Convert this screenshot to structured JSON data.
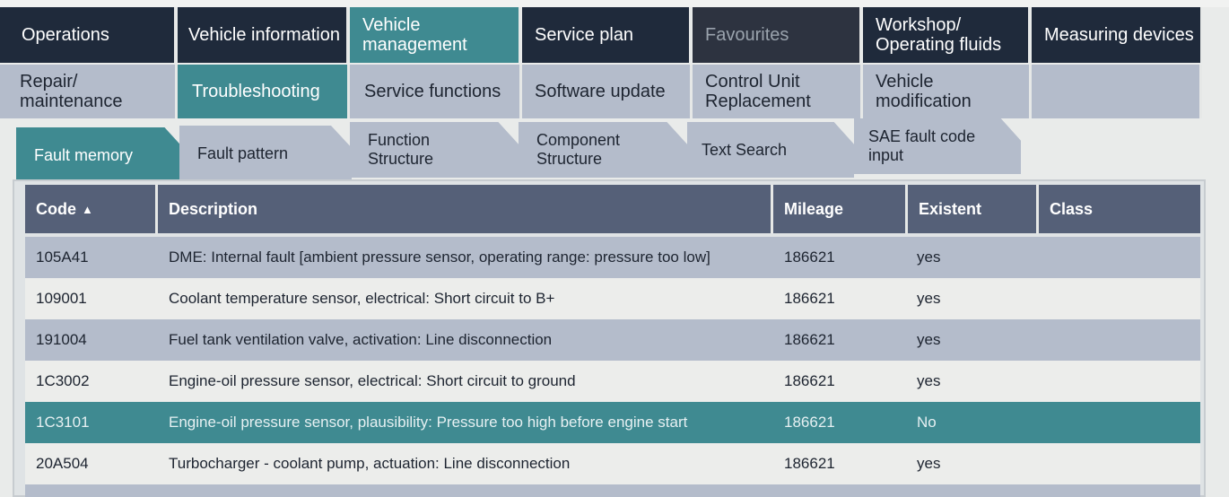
{
  "nav_main": [
    {
      "label": "Operations",
      "state": "dark"
    },
    {
      "label": "Vehicle information",
      "state": "dark"
    },
    {
      "label": "Vehicle management",
      "state": "active"
    },
    {
      "label": "Service plan",
      "state": "dark"
    },
    {
      "label": "Favourites",
      "state": "disabled"
    },
    {
      "label": "Workshop/ Operating fluids",
      "state": "dark"
    },
    {
      "label": "Measuring devices",
      "state": "dark"
    }
  ],
  "nav_sub": [
    {
      "label": "Repair/ maintenance"
    },
    {
      "label": "Troubleshooting",
      "active": true
    },
    {
      "label": "Service functions"
    },
    {
      "label": "Software update"
    },
    {
      "label": "Control Unit Replacement"
    },
    {
      "label": "Vehicle modification"
    }
  ],
  "nav_tabs": [
    {
      "label": "Fault memory",
      "active": true
    },
    {
      "label": "Fault pattern"
    },
    {
      "label": "Function Structure"
    },
    {
      "label": "Component Structure"
    },
    {
      "label": "Text Search"
    },
    {
      "label": "SAE fault code input"
    }
  ],
  "table": {
    "headers": {
      "code": "Code",
      "description": "Description",
      "mileage": "Mileage",
      "existent": "Existent",
      "class": "Class"
    },
    "sort_icon": "▲",
    "rows": [
      {
        "code": "105A41",
        "description": "DME: Internal fault [ambient pressure sensor, operating range: pressure too low]",
        "mileage": "186621",
        "existent": "yes",
        "class": ""
      },
      {
        "code": "109001",
        "description": "Coolant temperature sensor, electrical: Short circuit to B+",
        "mileage": "186621",
        "existent": "yes",
        "class": ""
      },
      {
        "code": "191004",
        "description": "Fuel tank ventilation valve, activation: Line disconnection",
        "mileage": "186621",
        "existent": "yes",
        "class": ""
      },
      {
        "code": "1C3002",
        "description": "Engine-oil pressure sensor, electrical: Short circuit to ground",
        "mileage": "186621",
        "existent": "yes",
        "class": ""
      },
      {
        "code": "1C3101",
        "description": "Engine-oil pressure sensor, plausibility: Pressure too high before engine start",
        "mileage": "186621",
        "existent": "No",
        "class": "",
        "selected": true
      },
      {
        "code": "20A504",
        "description": "Turbocharger - coolant pump, actuation: Line disconnection",
        "mileage": "186621",
        "existent": "yes",
        "class": ""
      }
    ]
  },
  "colors": {
    "dark": "#1f2a3b",
    "teal": "#3f8a91",
    "header": "#556078",
    "row_alt": "#b4bccb",
    "row_plain": "#ecedeb"
  }
}
